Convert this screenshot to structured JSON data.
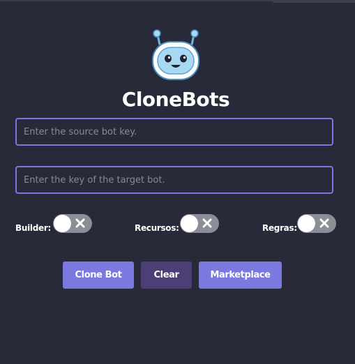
{
  "app": {
    "title": "CloneBots",
    "logo_icon": "robot-icon"
  },
  "inputs": {
    "source": {
      "placeholder": "Enter the source bot key.",
      "value": ""
    },
    "target": {
      "placeholder": "Enter the key of the target bot.",
      "value": ""
    }
  },
  "toggles": [
    {
      "label": "Builder:",
      "on": false,
      "icon": "close-icon"
    },
    {
      "label": "Recursos:",
      "on": false,
      "icon": "close-icon"
    },
    {
      "label": "Regras:",
      "on": false,
      "icon": "close-icon"
    }
  ],
  "buttons": {
    "clone": "Clone Bot",
    "clear": "Clear",
    "marketplace": "Marketplace"
  },
  "colors": {
    "background": "#282a3a",
    "accent": "#7b78e0",
    "clear_button": "#4b3f75",
    "toggle_off": "#8b8d97"
  }
}
